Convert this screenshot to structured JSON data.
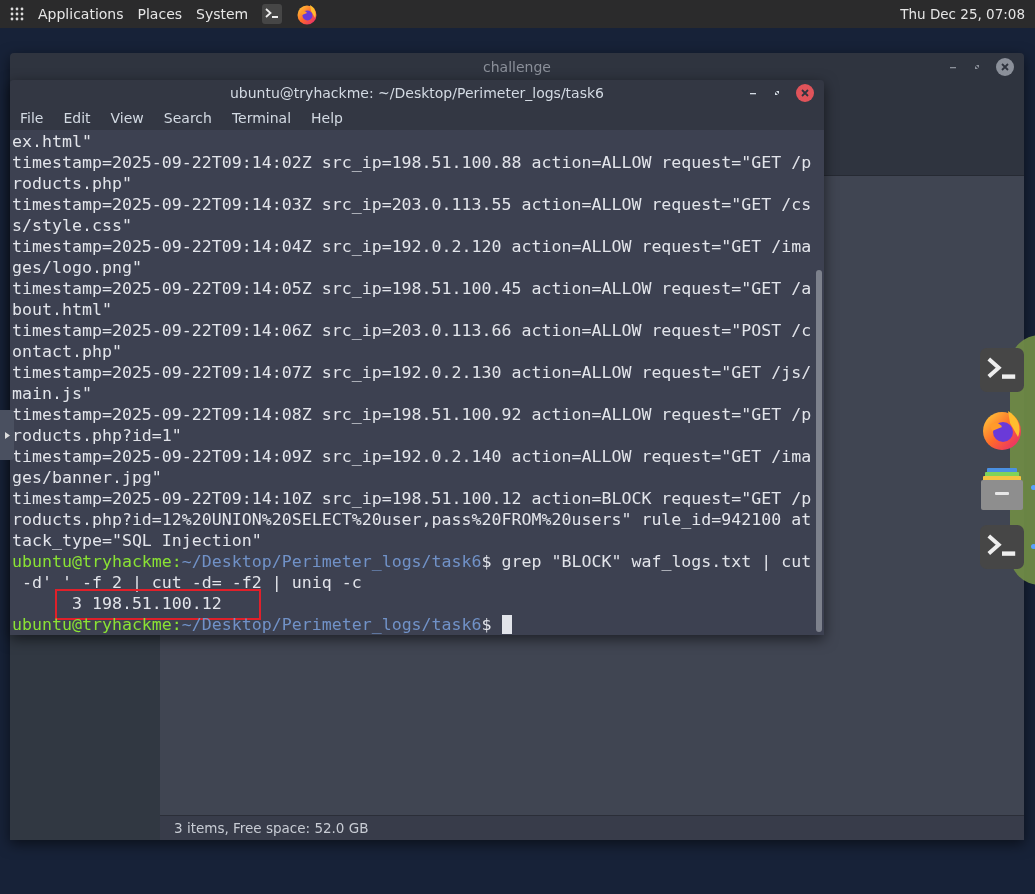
{
  "top_bar": {
    "menus": [
      {
        "label": "Applications"
      },
      {
        "label": "Places"
      },
      {
        "label": "System"
      }
    ],
    "clock": "Thu Dec 25, 07:08"
  },
  "file_manager": {
    "title": "challenge",
    "status_bar": "3 items, Free space: 52.0 GB"
  },
  "terminal": {
    "title": "ubuntu@tryhackme: ~/Desktop/Perimeter_logs/task6",
    "menu": [
      "File",
      "Edit",
      "View",
      "Search",
      "Terminal",
      "Help"
    ],
    "lines": [
      {
        "kind": "output",
        "text": "ex.html\"",
        "highlighted": false
      },
      {
        "kind": "output",
        "text": "timestamp=2025-09-22T09:14:02Z src_ip=198.51.100.88 action=ALLOW request=\"GET /p",
        "highlighted": false
      },
      {
        "kind": "output",
        "text": "roducts.php\"",
        "highlighted": false
      },
      {
        "kind": "output",
        "text": "timestamp=2025-09-22T09:14:03Z src_ip=203.0.113.55 action=ALLOW request=\"GET /cs",
        "highlighted": false
      },
      {
        "kind": "output",
        "text": "s/style.css\"",
        "highlighted": false
      },
      {
        "kind": "output",
        "text": "timestamp=2025-09-22T09:14:04Z src_ip=192.0.2.120 action=ALLOW request=\"GET /ima",
        "highlighted": false
      },
      {
        "kind": "output",
        "text": "ges/logo.png\"",
        "highlighted": false
      },
      {
        "kind": "output",
        "text": "timestamp=2025-09-22T09:14:05Z src_ip=198.51.100.45 action=ALLOW request=\"GET /a",
        "highlighted": false
      },
      {
        "kind": "output",
        "text": "bout.html\"",
        "highlighted": false
      },
      {
        "kind": "output",
        "text": "timestamp=2025-09-22T09:14:06Z src_ip=203.0.113.66 action=ALLOW request=\"POST /c",
        "highlighted": false
      },
      {
        "kind": "output",
        "text": "ontact.php\"",
        "highlighted": false
      },
      {
        "kind": "output",
        "text": "timestamp=2025-09-22T09:14:07Z src_ip=192.0.2.130 action=ALLOW request=\"GET /js/",
        "highlighted": false
      },
      {
        "kind": "output",
        "text": "main.js\"",
        "highlighted": false
      },
      {
        "kind": "output",
        "text": "timestamp=2025-09-22T09:14:08Z src_ip=198.51.100.92 action=ALLOW request=\"GET /p",
        "highlighted": false
      },
      {
        "kind": "output",
        "text": "roducts.php?id=1\"",
        "highlighted": false
      },
      {
        "kind": "output",
        "text": "timestamp=2025-09-22T09:14:09Z src_ip=192.0.2.140 action=ALLOW request=\"GET /ima",
        "highlighted": false
      },
      {
        "kind": "output",
        "text": "ges/banner.jpg\"",
        "highlighted": false
      },
      {
        "kind": "output",
        "text": "timestamp=2025-09-22T09:14:10Z src_ip=198.51.100.12 action=BLOCK request=\"GET /p",
        "highlighted": false
      },
      {
        "kind": "output",
        "text": "roducts.php?id=12%20UNION%20SELECT%20user,pass%20FROM%20users\" rule_id=942100 at",
        "highlighted": false
      },
      {
        "kind": "output",
        "text": "tack_type=\"SQL Injection\"",
        "highlighted": false
      },
      {
        "kind": "prompt",
        "user": "ubuntu@tryhackme:",
        "path": "~/Desktop/Perimeter_logs/task6",
        "command": "$ grep \"BLOCK\" waf_logs.txt | cut",
        "cursor": false,
        "highlighted": false
      },
      {
        "kind": "output",
        "text": " -d' ' -f 2 | cut -d= -f2 | uniq -c",
        "highlighted": false
      },
      {
        "kind": "output",
        "text": "      3 198.51.100.12",
        "highlighted": true
      },
      {
        "kind": "prompt",
        "user": "ubuntu@tryhackme:",
        "path": "~/Desktop/Perimeter_logs/task6",
        "command": "$",
        "cursor": true,
        "highlighted": false
      }
    ]
  },
  "dock": {
    "items": [
      {
        "kind": "terminal",
        "running": false
      },
      {
        "kind": "browser",
        "running": false
      },
      {
        "kind": "files",
        "running": true
      },
      {
        "kind": "terminal",
        "running": true
      }
    ]
  }
}
